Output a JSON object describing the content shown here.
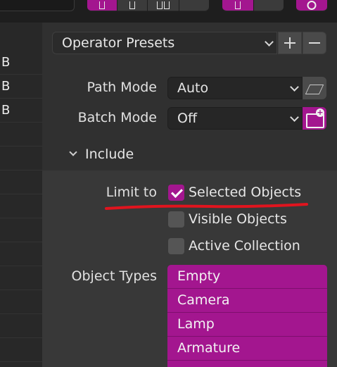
{
  "colors": {
    "accent": "#a3168f",
    "panel": "#303030",
    "annotation": "#e0141e"
  },
  "left_list": {
    "rows": [
      "B",
      "B",
      "B"
    ]
  },
  "presets": {
    "label": "Operator Presets",
    "add_icon": "plus-icon",
    "remove_icon": "minus-icon"
  },
  "path_mode": {
    "label": "Path Mode",
    "value": "Auto",
    "icon": "cube-icon"
  },
  "batch_mode": {
    "label": "Batch Mode",
    "value": "Off",
    "icon": "folder-add-icon"
  },
  "include": {
    "title": "Include",
    "limit_label": "Limit to",
    "options": [
      {
        "label": "Selected Objects",
        "checked": true
      },
      {
        "label": "Visible Objects",
        "checked": false
      },
      {
        "label": "Active Collection",
        "checked": false
      }
    ],
    "object_types_label": "Object Types",
    "object_types": [
      "Empty",
      "Camera",
      "Lamp",
      "Armature"
    ]
  }
}
